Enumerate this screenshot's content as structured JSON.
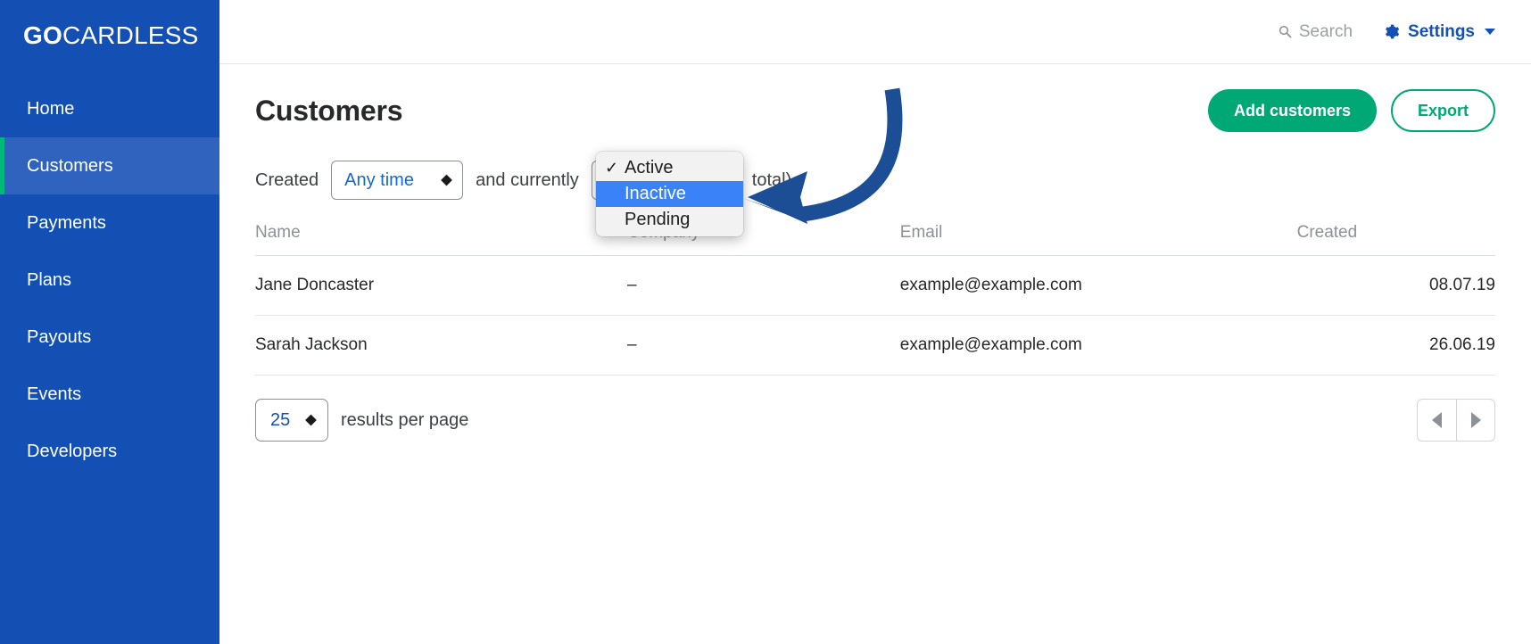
{
  "brand": {
    "bold": "GO",
    "light": "CARDLESS"
  },
  "sidebar": {
    "items": [
      {
        "label": "Home",
        "active": false
      },
      {
        "label": "Customers",
        "active": true
      },
      {
        "label": "Payments",
        "active": false
      },
      {
        "label": "Plans",
        "active": false
      },
      {
        "label": "Payouts",
        "active": false
      },
      {
        "label": "Events",
        "active": false
      },
      {
        "label": "Developers",
        "active": false
      }
    ]
  },
  "topbar": {
    "search_placeholder": "Search",
    "settings_label": "Settings",
    "search_icon": "search-icon",
    "gear_icon": "gear-icon",
    "caret_icon": "chevron-down-icon"
  },
  "page": {
    "title": "Customers",
    "add_label": "Add customers",
    "export_label": "Export"
  },
  "filter": {
    "prefix": "Created",
    "time_value": "Any time",
    "middle": "and currently",
    "status_value": "Inactive",
    "suffix": "total)"
  },
  "dropdown": {
    "open": true,
    "options": [
      {
        "label": "Active",
        "checked": true,
        "highlighted": false
      },
      {
        "label": "Inactive",
        "checked": false,
        "highlighted": true
      },
      {
        "label": "Pending",
        "checked": false,
        "highlighted": false
      }
    ],
    "check_glyph": "✓",
    "highlight_color": "#3a82f7"
  },
  "table": {
    "columns": [
      "Name",
      "Company",
      "Email",
      "Created"
    ],
    "rows": [
      {
        "name": "Jane Doncaster",
        "company": "–",
        "email": "example@example.com",
        "created": "08.07.19"
      },
      {
        "name": "Sarah Jackson",
        "company": "–",
        "email": "example@example.com",
        "created": "26.06.19"
      }
    ]
  },
  "pager": {
    "per_page_value": "25",
    "per_page_label": "results per page",
    "prev_icon": "triangle-left-icon",
    "next_icon": "triangle-right-icon"
  },
  "annotation": {
    "arrow_color": "#1c4e96",
    "arrow_icon": "curved-arrow-annotation"
  },
  "colors": {
    "sidebar": "#1450b4",
    "sidebar_active": "#2f63be",
    "accent_green": "#00a876",
    "active_marker": "#00b87c",
    "link_blue": "#1469cf"
  }
}
